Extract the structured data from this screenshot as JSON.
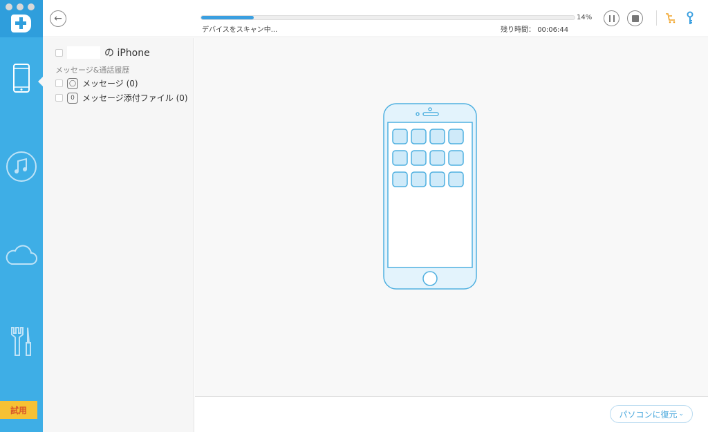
{
  "sidebar": {
    "items": [
      {
        "icon": "phone-icon",
        "active": true
      },
      {
        "icon": "music-icon"
      },
      {
        "icon": "cloud-icon"
      },
      {
        "icon": "tools-icon"
      }
    ],
    "trial_label": "試用"
  },
  "header": {
    "progress_percent": 14,
    "progress_label": "14%",
    "status": "デバイスをスキャン中...",
    "remaining_label": "残り時間：",
    "remaining_time": "00:06:44"
  },
  "tree": {
    "device_name_suffix": "の iPhone",
    "section": "メッセージ&通話履歴",
    "items": [
      {
        "label": "メッセージ (0)",
        "icon": "message-bubble-icon"
      },
      {
        "label": "メッセージ添付ファイル (0)",
        "icon": "paperclip-icon"
      }
    ]
  },
  "footer": {
    "restore_label": "パソコンに復元"
  },
  "colors": {
    "accent": "#3eaee6",
    "trial": "#f6c134",
    "cart": "#f0a020",
    "key": "#3a9fe0"
  }
}
